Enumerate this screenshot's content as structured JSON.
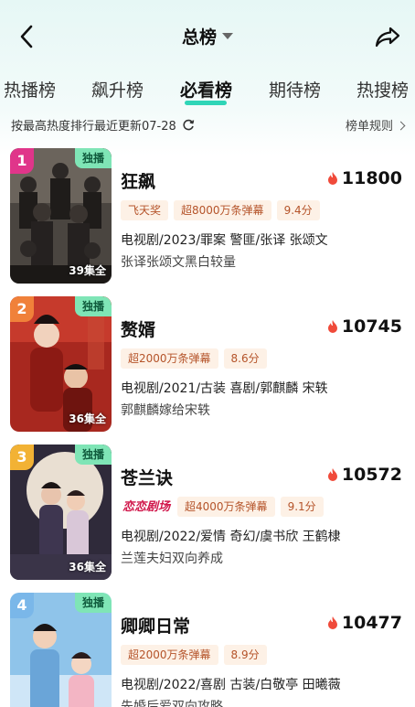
{
  "header": {
    "title": "总榜"
  },
  "tabs": [
    {
      "label": "热播榜"
    },
    {
      "label": "飙升榜"
    },
    {
      "label": "必看榜",
      "active": true
    },
    {
      "label": "期待榜"
    },
    {
      "label": "热搜榜"
    }
  ],
  "subheader": {
    "left": "按最高热度排行最近更新07-28",
    "right": "榜单规则"
  },
  "colors": {
    "accent": "#2fd5b7",
    "rank1": "#e0358a",
    "rank2": "#f0813a",
    "rank3": "#f2b234",
    "rank4": "#7ab7e9",
    "flame": "#f04a3a"
  },
  "items": [
    {
      "rank": "1",
      "exclusive": "独播",
      "episodes": "39集全",
      "name": "狂飙",
      "heat": "11800",
      "tags": [
        "飞天奖",
        "超8000万条弹幕",
        "9.4分"
      ],
      "meta": "电视剧/2023/罪案 警匪/张译 张颂文",
      "desc": "张译张颂文黑白较量"
    },
    {
      "rank": "2",
      "exclusive": "独播",
      "episodes": "36集全",
      "name": "赘婿",
      "heat": "10745",
      "tags": [
        "超2000万条弹幕",
        "8.6分"
      ],
      "meta": "电视剧/2021/古装 喜剧/郭麒麟 宋轶",
      "desc": "郭麒麟嫁给宋轶"
    },
    {
      "rank": "3",
      "exclusive": "独播",
      "episodes": "36集全",
      "name": "苍兰诀",
      "heat": "10572",
      "logo": "恋恋剧场",
      "tags": [
        "超4000万条弹幕",
        "9.1分"
      ],
      "meta": "电视剧/2022/爱情 奇幻/虞书欣 王鹤棣",
      "desc": "兰莲夫妇双向养成"
    },
    {
      "rank": "4",
      "exclusive": "独播",
      "episodes": "",
      "name": "卿卿日常",
      "heat": "10477",
      "tags": [
        "超2000万条弹幕",
        "8.9分"
      ],
      "meta": "电视剧/2022/喜剧 古装/白敬亭 田曦薇",
      "desc": "先婚后爱双向攻略"
    }
  ]
}
